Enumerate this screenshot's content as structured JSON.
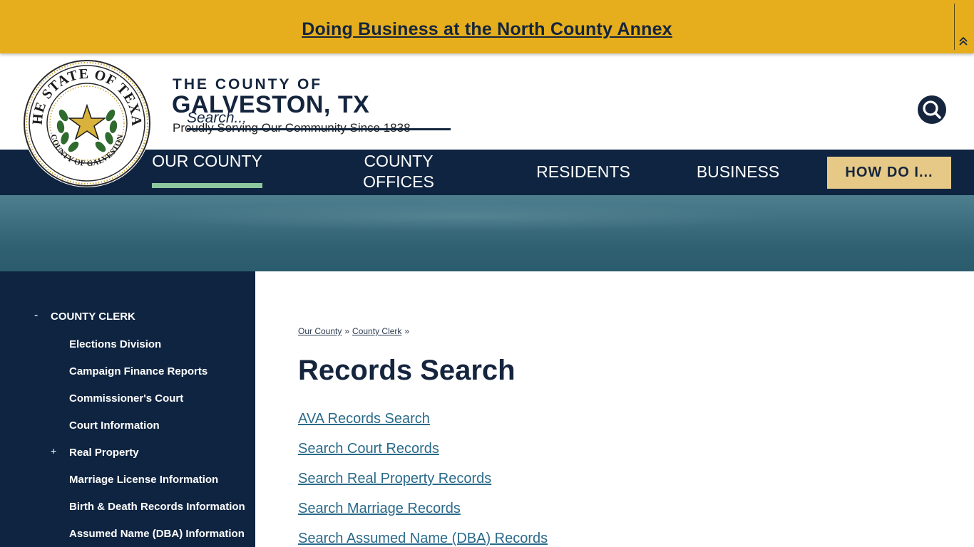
{
  "alert": {
    "link_text": "Doing Business at the North County Annex",
    "collapse_icon": "double-chevron-up-icon"
  },
  "header": {
    "seal": {
      "outer_text": "THE STATE OF TEXAS",
      "inner_text": "COUNTY OF GALVESTON",
      "icon": "texas-star-seal"
    },
    "brand_small": "THE COUNTY OF",
    "brand_big": "GALVESTON, TX",
    "tagline": "Proudly Serving Our Community Since 1838",
    "search_placeholder": "Search...",
    "search_icon": "search-icon"
  },
  "nav": {
    "items": [
      {
        "label": "OUR COUNTY"
      },
      {
        "label": "COUNTY OFFICES"
      },
      {
        "label": "RESIDENTS"
      },
      {
        "label": "BUSINESS"
      }
    ],
    "how_do_i": "HOW DO I..."
  },
  "sidebar": {
    "section_toggle": "-",
    "section_title": "COUNTY CLERK",
    "items": [
      {
        "label": "Elections Division",
        "toggle": ""
      },
      {
        "label": "Campaign Finance Reports",
        "toggle": ""
      },
      {
        "label": "Commissioner's Court",
        "toggle": ""
      },
      {
        "label": "Court Information",
        "toggle": ""
      },
      {
        "label": "Real Property",
        "toggle": "+"
      },
      {
        "label": "Marriage License Information",
        "toggle": ""
      },
      {
        "label": "Birth & Death Records Information",
        "toggle": ""
      },
      {
        "label": "Assumed Name (DBA) Information",
        "toggle": ""
      }
    ]
  },
  "breadcrumb": {
    "items": [
      "Our County",
      "County Clerk"
    ],
    "separator": "»"
  },
  "main": {
    "title": "Records Search",
    "links": [
      "AVA Records Search",
      "Search Court Records",
      "Search Real Property Records",
      "Search Marriage Records",
      "Search Assumed Name (DBA) Records"
    ]
  },
  "colors": {
    "alert_bg": "#e6ae1c",
    "navy": "#0f2440",
    "nav_active": "#8dc79d",
    "how_do_i_bg": "#e7c987",
    "link": "#2a6a8a"
  }
}
